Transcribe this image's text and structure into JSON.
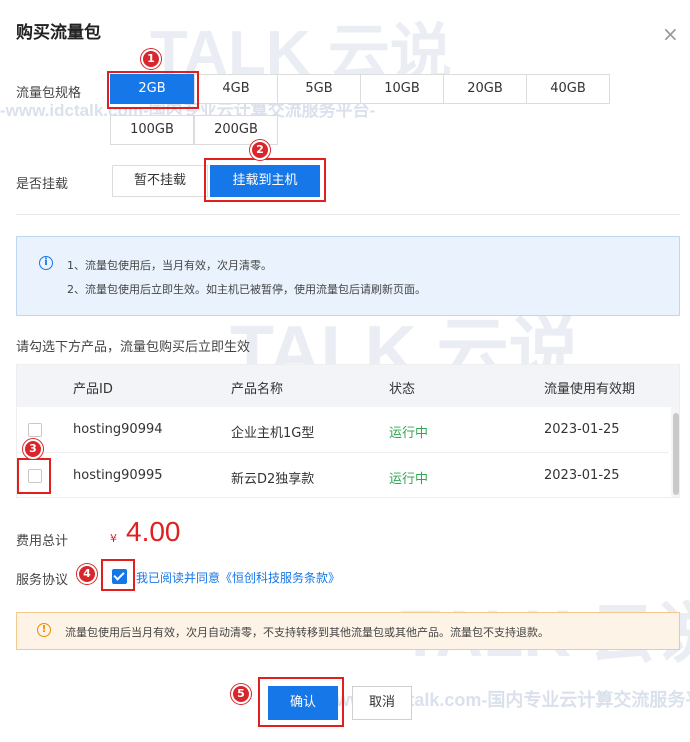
{
  "dialog": {
    "title": "购买流量包",
    "close_symbol": "×"
  },
  "spec": {
    "label": "流量包规格",
    "options": [
      "2GB",
      "4GB",
      "5GB",
      "10GB",
      "20GB",
      "40GB",
      "100GB",
      "200GB"
    ],
    "selected": "2GB"
  },
  "mount": {
    "label": "是否挂载",
    "options": [
      "暂不挂载",
      "挂载到主机"
    ],
    "selected": "挂载到主机"
  },
  "notice": {
    "icon": "info-icon",
    "lines": [
      "1、流量包使用后，当月有效，次月清零。",
      "2、流量包使用后立即生效。如主机已被暂停，使用流量包后请刷新页面。"
    ]
  },
  "product_hint": "请勾选下方产品，流量包购买后立即生效",
  "table": {
    "columns": [
      "产品ID",
      "产品名称",
      "状态",
      "流量使用有效期"
    ],
    "rows": [
      {
        "id": "hosting90994",
        "name": "企业主机1G型",
        "status": "运行中",
        "expiry": "2023-01-25"
      },
      {
        "id": "hosting90995",
        "name": "新云D2独享款",
        "status": "运行中",
        "expiry": "2023-01-25"
      }
    ]
  },
  "total": {
    "label": "费用总计",
    "currency": "¥",
    "amount": "4.00"
  },
  "agreement": {
    "label": "服务协议",
    "checked": true,
    "text": "我已阅读并同意《恒创科技服务条款》"
  },
  "warning": {
    "icon": "warning-icon",
    "text": "流量包使用后当月有效，次月自动清零，不支持转移到其他流量包或其他产品。流量包不支持退款。"
  },
  "buttons": {
    "confirm": "确认",
    "cancel": "取消"
  },
  "markers": [
    "1",
    "2",
    "3",
    "4",
    "5"
  ],
  "watermarks": {
    "brand": "TALK 云说",
    "site": "-www.idctalk.com-国内专业云计算交流服务平台-"
  },
  "colors": {
    "accent": "#1677e8",
    "price": "#e02020",
    "status_running": "#2fa84f",
    "annotation": "#e11f1f"
  }
}
